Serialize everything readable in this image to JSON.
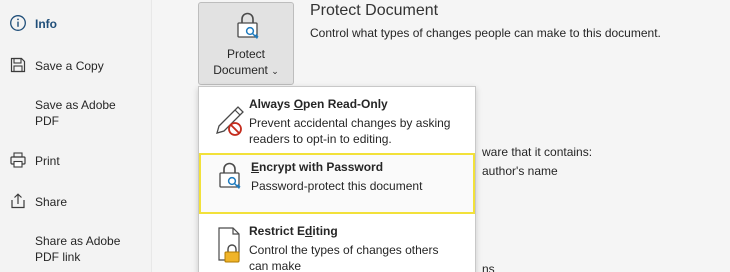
{
  "nav": {
    "items": [
      {
        "label": "Info",
        "icon": "info-icon",
        "active": true
      },
      {
        "label": "Save a Copy",
        "icon": "save-icon"
      },
      {
        "label": "Save as Adobe\nPDF",
        "icon": ""
      },
      {
        "label": "Print",
        "icon": "print-icon"
      },
      {
        "label": "Share",
        "icon": "share-icon"
      },
      {
        "label": "Share as Adobe\nPDF link",
        "icon": ""
      }
    ]
  },
  "protect": {
    "button_line1": "Protect",
    "button_line2": "Document",
    "title": "Protect Document",
    "description": "Control what types of changes people can make to this document."
  },
  "background": {
    "inspect_partial": "ware that it contains:",
    "author_partial": "author's name",
    "bottom_partial": "ns"
  },
  "menu": {
    "items": [
      {
        "title_pre": "Always ",
        "title_ul": "O",
        "title_post": "pen Read-Only",
        "desc": "Prevent accidental changes by asking\nreaders to opt-in to editing.",
        "icon": "pencil-prohibited-icon"
      },
      {
        "title_pre": "",
        "title_ul": "E",
        "title_post": "ncrypt with Password",
        "desc": "Password-protect this document",
        "icon": "lock-key-icon"
      },
      {
        "title_pre": "Restrict E",
        "title_ul": "d",
        "title_post": "iting",
        "desc": "Control the types of changes others\ncan make",
        "icon": "document-lock-icon"
      }
    ]
  },
  "colors": {
    "highlight": "#f2e13a",
    "active_nav": "#1f4e79"
  }
}
